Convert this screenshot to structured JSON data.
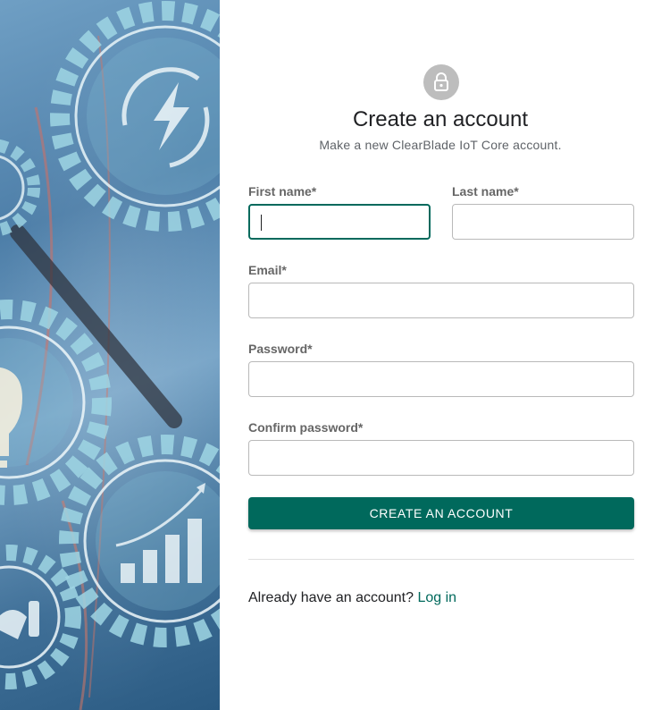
{
  "form": {
    "title": "Create an account",
    "subtitle": "Make a new ClearBlade IoT Core account.",
    "fields": {
      "first_name": {
        "label": "First name*",
        "value": ""
      },
      "last_name": {
        "label": "Last name*",
        "value": ""
      },
      "email": {
        "label": "Email*",
        "value": ""
      },
      "password": {
        "label": "Password*",
        "value": ""
      },
      "confirm_password": {
        "label": "Confirm password*",
        "value": ""
      }
    },
    "submit_label": "CREATE AN ACCOUNT",
    "login_prompt": "Already have an account?",
    "login_link": "Log in"
  },
  "icons": {
    "header": "lock-icon"
  },
  "colors": {
    "accent": "#00695c",
    "icon_bg": "#bdbdbd",
    "hero_base": "#4d7ea8"
  }
}
